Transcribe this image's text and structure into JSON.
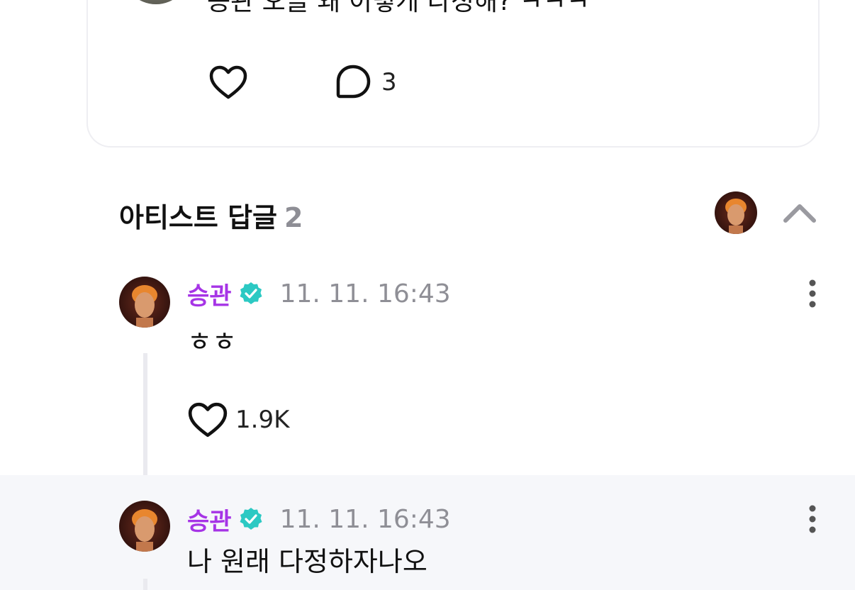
{
  "post": {
    "text": "승관 오늘 왜 이렇게 다정해? ㅋㅋㅋ",
    "comment_count": "3",
    "icons": {
      "like": "heart-outline-icon",
      "comment": "speech-bubble-icon"
    }
  },
  "artist_replies": {
    "title": "아티스트 답글",
    "count": "2",
    "icons": {
      "collapse": "chevron-up-icon"
    }
  },
  "replies": [
    {
      "author": "승관",
      "timestamp": "11. 11. 16:43",
      "text": "ㅎㅎ",
      "like_count": "1.9K"
    },
    {
      "author": "승관",
      "timestamp": "11. 11. 16:43",
      "text": "나 원래 다정하자나오"
    }
  ],
  "colors": {
    "artist_name": "#a634e6",
    "verified_badge": "#2cc9c3",
    "timestamp": "#8f8f96",
    "highlight_row": "#f6f7fa",
    "thread_line": "#eaeaef"
  }
}
